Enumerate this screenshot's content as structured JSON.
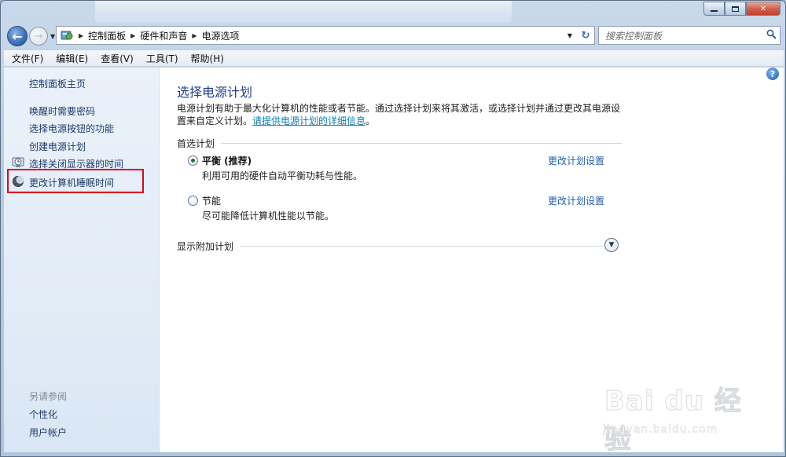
{
  "window": {
    "caption_min": "",
    "caption_max": "",
    "caption_close": "✕"
  },
  "nav": {
    "back_icon": "back-arrow-icon",
    "forward_icon": "forward-arrow-icon",
    "breadcrumb": [
      "控制面板",
      "硬件和声音",
      "电源选项"
    ]
  },
  "search": {
    "placeholder": "搜索控制面板"
  },
  "menu": [
    "文件(F)",
    "编辑(E)",
    "查看(V)",
    "工具(T)",
    "帮助(H)"
  ],
  "sidebar": {
    "home": "控制面板主页",
    "links": [
      {
        "label": "唤醒时需要密码",
        "icon": ""
      },
      {
        "label": "选择电源按钮的功能",
        "icon": ""
      },
      {
        "label": "创建电源计划",
        "icon": ""
      },
      {
        "label": "选择关闭显示器的时间",
        "icon": "clock-icon"
      },
      {
        "label": "更改计算机睡眠时间",
        "icon": "moon-icon"
      }
    ],
    "see_also_title": "另请参阅",
    "see_also": [
      "个性化",
      "用户帐户"
    ]
  },
  "main": {
    "title": "选择电源计划",
    "description": "电源计划有助于最大化计算机的性能或者节能。通过选择计划来将其激活，或选择计划并通过更改其电源设置来自定义计划。",
    "description_link": "请提供电源计划的详细信息",
    "description_end": "。",
    "preferred_header": "首选计划",
    "plans": [
      {
        "name": "平衡 (推荐)",
        "desc": "利用可用的硬件自动平衡功耗与性能。",
        "link": "更改计划设置",
        "selected": true
      },
      {
        "name": "节能",
        "desc": "尽可能降低计算机性能以节能。",
        "link": "更改计划设置",
        "selected": false
      }
    ],
    "additional_header": "显示附加计划"
  },
  "watermark": {
    "main": "Bai du 经验",
    "sub": "jingyan.baidu.com"
  }
}
